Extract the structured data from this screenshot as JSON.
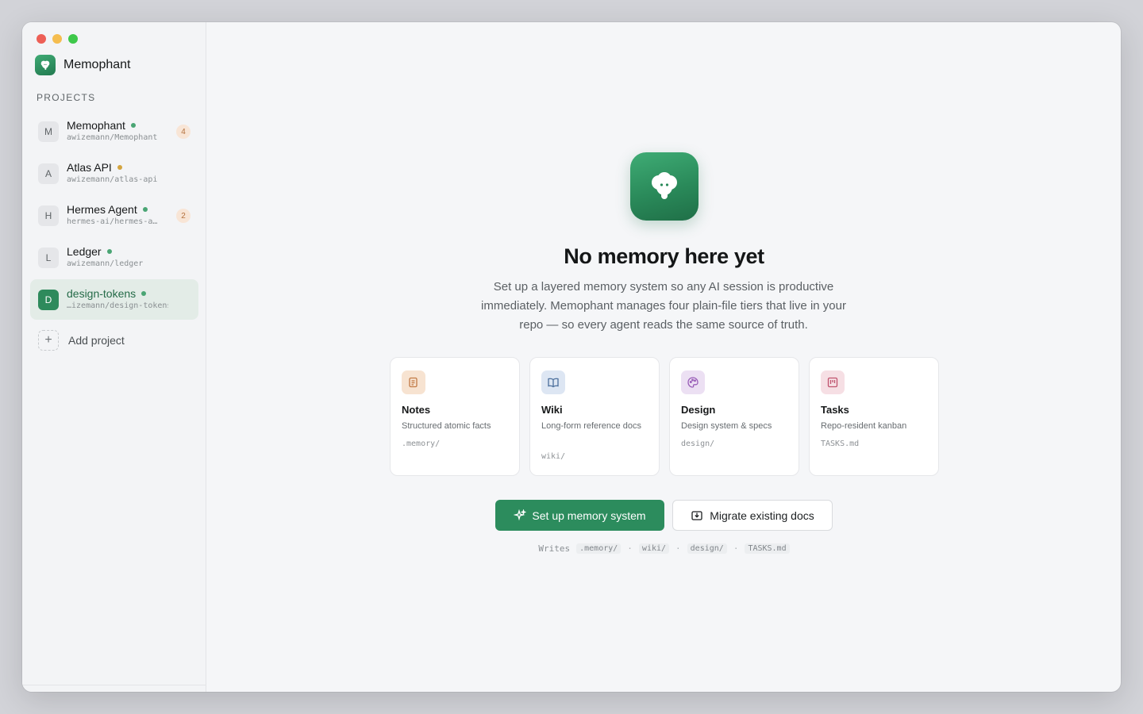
{
  "app": {
    "name": "Memophant"
  },
  "sidebar": {
    "section_label": "PROJECTS",
    "projects": [
      {
        "initial": "M",
        "name": "Memophant",
        "path": "awizemann/Memophant",
        "status_color": "#4aa574",
        "badge": "4",
        "active": false
      },
      {
        "initial": "A",
        "name": "Atlas API",
        "path": "awizemann/atlas-api",
        "status_color": "#d3a43f",
        "badge": "",
        "active": false
      },
      {
        "initial": "H",
        "name": "Hermes Agent",
        "path": "hermes-ai/hermes-a…",
        "status_color": "#4aa574",
        "badge": "2",
        "active": false
      },
      {
        "initial": "L",
        "name": "Ledger",
        "path": "awizemann/ledger",
        "status_color": "#4aa574",
        "badge": "",
        "active": false
      },
      {
        "initial": "D",
        "name": "design-tokens",
        "path": "…izemann/design-tokens",
        "status_color": "#4aa574",
        "badge": "",
        "active": true
      }
    ],
    "add_project_label": "Add project"
  },
  "main": {
    "headline": "No memory here yet",
    "subtitle": "Set up a layered memory system so any AI session is productive immediately. Memophant manages four plain-file tiers that live in your repo — so every agent reads the same source of truth.",
    "tiers": [
      {
        "title": "Notes",
        "desc": "Structured atomic facts",
        "path": ".memory/",
        "icon": "notes-icon",
        "icon_bg": "#f7e3d1",
        "icon_color": "#c27a45"
      },
      {
        "title": "Wiki",
        "desc": "Long-form reference docs",
        "path": "wiki/",
        "icon": "book-icon",
        "icon_bg": "#dde6f3",
        "icon_color": "#4b6f9c"
      },
      {
        "title": "Design",
        "desc": "Design system & specs",
        "path": "design/",
        "icon": "palette-icon",
        "icon_bg": "#ece0f3",
        "icon_color": "#9a5fb8"
      },
      {
        "title": "Tasks",
        "desc": "Repo-resident kanban",
        "path": "TASKS.md",
        "icon": "kanban-icon",
        "icon_bg": "#f6dfe4",
        "icon_color": "#c0536e"
      }
    ],
    "primary_button": "Set up memory system",
    "secondary_button": "Migrate existing docs",
    "writes_label": "Writes",
    "writes_paths": [
      ".memory/",
      "wiki/",
      "design/",
      "TASKS.md"
    ]
  }
}
